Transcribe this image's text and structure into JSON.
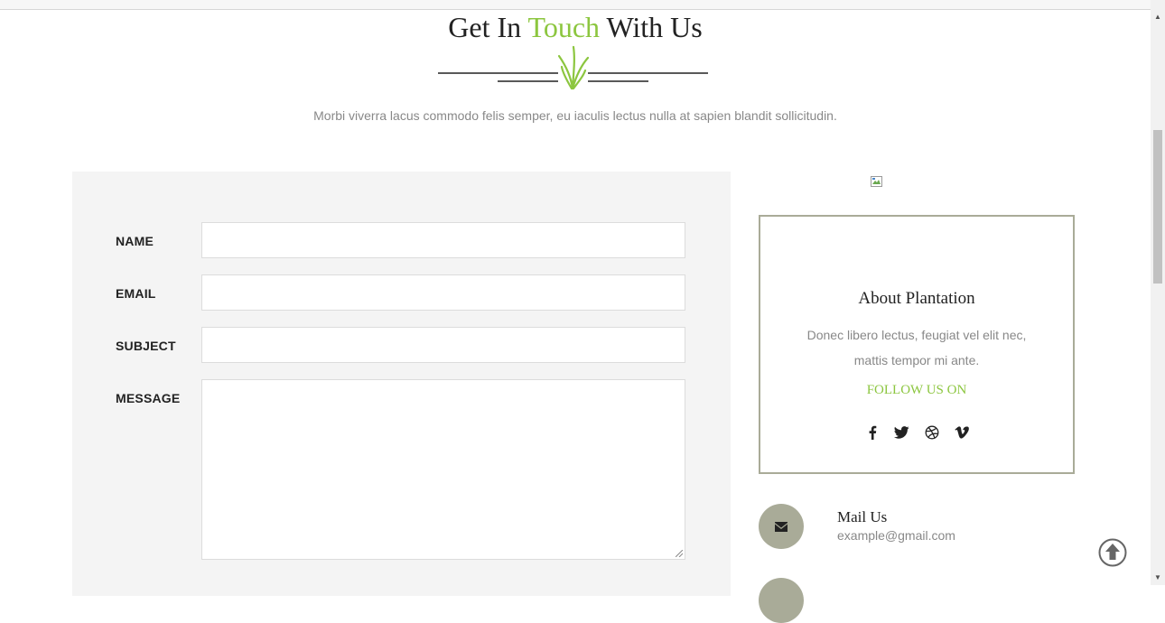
{
  "header": {
    "title_part1": "Get In ",
    "title_accent": "Touch",
    "title_part3": " With Us",
    "subtitle": "Morbi viverra lacus commodo felis semper, eu iaculis lectus nulla at sapien blandit sollicitudin."
  },
  "form": {
    "name_label": "NAME",
    "email_label": "EMAIL",
    "subject_label": "SUBJECT",
    "message_label": "MESSAGE",
    "name_value": "",
    "email_value": "",
    "subject_value": "",
    "message_value": ""
  },
  "about": {
    "title": "About Plantation",
    "text": "Donec libero lectus, feugiat vel elit nec, mattis tempor mi ante.",
    "follow_label": "FOLLOW US ON",
    "social_icons": [
      "facebook-icon",
      "twitter-icon",
      "dribbble-icon",
      "vimeo-icon"
    ]
  },
  "contact": {
    "mail_title": "Mail Us",
    "mail_value": "example@gmail.com"
  },
  "colors": {
    "accent": "#8cc63f",
    "muted_olive": "#a9ab98",
    "panel_bg": "#f4f4f4",
    "text_dark": "#222222",
    "text_muted": "#888888"
  }
}
